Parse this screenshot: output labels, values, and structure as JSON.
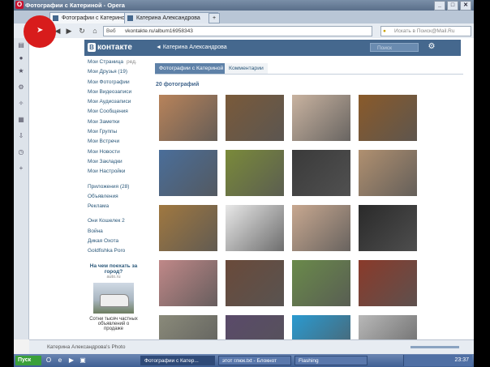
{
  "window": {
    "title": "Фотографии с Катериной - Opera",
    "logo_letter": "O",
    "buttons": {
      "minimize": "_",
      "maximize": "□",
      "close": "✕"
    }
  },
  "tabs": [
    {
      "label": "Фотографии с Катериной",
      "close": "✕"
    },
    {
      "label": "Катерина Александрова",
      "close": "✕"
    }
  ],
  "new_tab": "+",
  "nav": {
    "back": "◀",
    "forward": "▶",
    "reload": "↻",
    "home": "⌂",
    "web_label": "Веб",
    "url": "vkontakte.ru/album16958343",
    "search_placeholder": "Искать в Поиск@Mail.Ru"
  },
  "vk": {
    "logo_b": "В",
    "logo_text": "контакте",
    "breadcrumb": "◄ Катерина Александрова",
    "search_placeholder": "Поиск",
    "menu": [
      {
        "label": "Мои Страница",
        "count": "ред."
      },
      {
        "label": "Мои Друзья (19)"
      },
      {
        "label": "Мои Фотографии"
      },
      {
        "label": "Мои Видеозаписи"
      },
      {
        "label": "Мои Аудиозаписи"
      },
      {
        "label": "Мои Сообщения"
      },
      {
        "label": "Мои Заметки"
      },
      {
        "label": "Мои Группы"
      },
      {
        "label": "Мои Встречи"
      },
      {
        "label": "Мои Новости"
      },
      {
        "label": "Мои Закладки"
      },
      {
        "label": "Мои Настройки"
      }
    ],
    "menu2": [
      {
        "label": "Приложения (28)"
      },
      {
        "label": "Объявления"
      },
      {
        "label": "Реклама"
      }
    ],
    "menu3": [
      {
        "label": "Они Кошелек 2"
      },
      {
        "label": "Война"
      },
      {
        "label": "Дикая Охота"
      },
      {
        "label": "Goldfishka Poro"
      }
    ],
    "ad": {
      "title": "На чем поехать за город?",
      "source": "auto.ru",
      "description": "Сотни тысяч частных объявлений о продаже"
    },
    "tabs": [
      {
        "label": "Фотографии с Катериной",
        "active": true
      },
      {
        "label": "Комментарии",
        "active": false
      }
    ],
    "photo_count": "20 фотографий"
  },
  "photos": [
    {
      "bg": "#b8835a"
    },
    {
      "bg": "#7a5a3a"
    },
    {
      "bg": "#c9b3a0"
    },
    {
      "bg": "#8a5a2a"
    },
    {
      "bg": "#4a6e9a"
    },
    {
      "bg": "#7a8a3a"
    },
    {
      "bg": "#3a3a3a"
    },
    {
      "bg": "#b09070"
    },
    {
      "bg": "#a07840"
    },
    {
      "bg": "#e8e8e8"
    },
    {
      "bg": "#c8a890"
    },
    {
      "bg": "#2a2a2a"
    },
    {
      "bg": "#c08888"
    },
    {
      "bg": "#6a4a3a"
    },
    {
      "bg": "#6a8a4a"
    },
    {
      "bg": "#8a3a2a"
    },
    {
      "bg": "#8a8a7a"
    },
    {
      "bg": "#5a4a6a"
    },
    {
      "bg": "#2a9ad0"
    },
    {
      "bg": "#b8b8b8"
    }
  ],
  "statusbar": {
    "text": "Катерина Александрова's Photo"
  },
  "taskbar": {
    "start": "Пуск",
    "tasks": [
      {
        "label": "Фотографии с Катер...",
        "active": true
      },
      {
        "label": "этот глюк.txt - Блокнот",
        "active": false
      },
      {
        "label": "Flashing",
        "active": false
      }
    ],
    "clock": "23:37"
  }
}
